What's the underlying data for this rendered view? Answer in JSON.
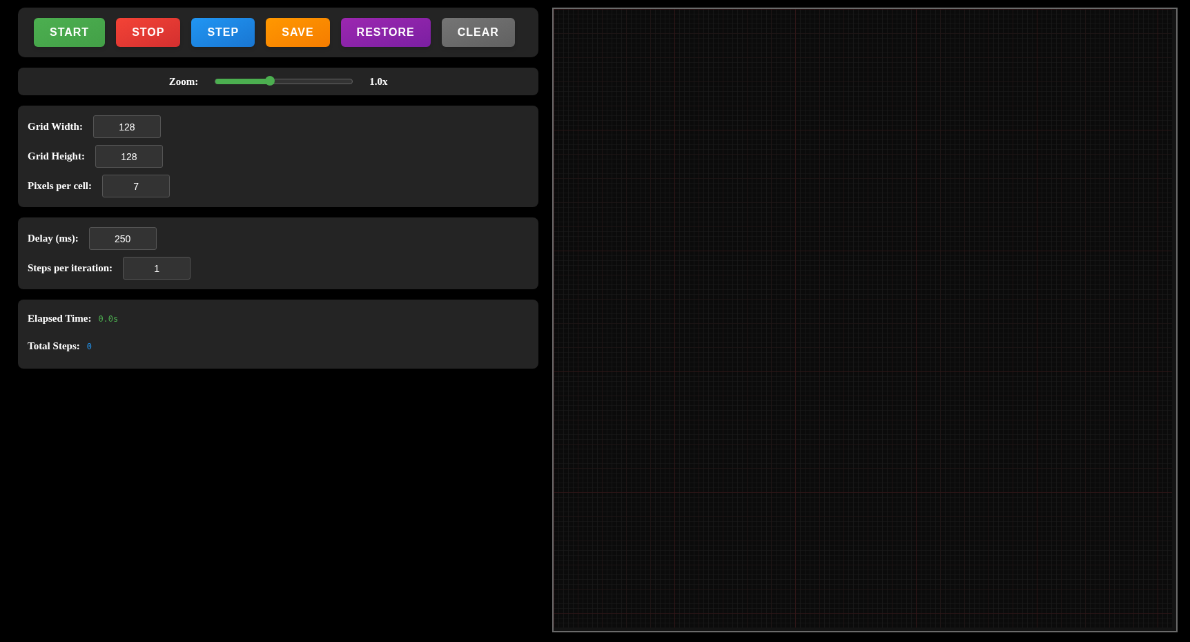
{
  "buttons": [
    {
      "label": "START",
      "kind": "start"
    },
    {
      "label": "STOP",
      "kind": "stop"
    },
    {
      "label": "STEP",
      "kind": "step"
    },
    {
      "label": "SAVE",
      "kind": "save"
    },
    {
      "label": "RESTORE",
      "kind": "restore"
    },
    {
      "label": "CLEAR",
      "kind": "clear"
    }
  ],
  "zoom": {
    "label": "Zoom:",
    "level": 0.4,
    "reading": "1.0x"
  },
  "settings_groups": [
    [
      {
        "label": "Grid Width:",
        "value": "128"
      },
      {
        "label": "Grid Height:",
        "value": "128"
      },
      {
        "label": "Pixels per cell:",
        "value": "7"
      }
    ],
    [
      {
        "label": "Delay (ms):",
        "value": "250"
      },
      {
        "label": "Steps per iteration:",
        "value": "1"
      }
    ]
  ],
  "stats": [
    {
      "label": "Elapsed Time:",
      "value": "0.0s",
      "kind": "time"
    },
    {
      "label": "Total Steps:",
      "value": "0",
      "kind": "steps"
    }
  ]
}
